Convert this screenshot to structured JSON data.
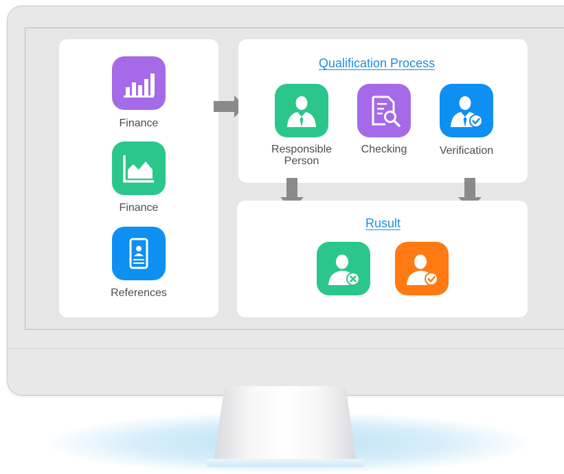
{
  "sources": [
    {
      "label": "Finance",
      "icon": "bar-chart-icon",
      "color": "#a56ae8"
    },
    {
      "label": "Finance",
      "icon": "area-chart-icon",
      "color": "#2bc68c"
    },
    {
      "label": "References",
      "icon": "id-card-icon",
      "color": "#0e8ff2"
    }
  ],
  "process": {
    "title": "Qualification Process ",
    "steps": [
      {
        "label": "Responsible Person",
        "icon": "person-icon",
        "color": "#2bc68c"
      },
      {
        "label": "Checking",
        "icon": "document-search-icon",
        "color": "#a56ae8"
      },
      {
        "label": "Verification",
        "icon": "person-check-icon",
        "color": "#0e8ff2"
      }
    ]
  },
  "result": {
    "title": "Rusult",
    "items": [
      {
        "icon": "person-rejected-icon",
        "color": "#2bc68c"
      },
      {
        "icon": "person-approved-icon",
        "color": "#ff7a12"
      }
    ]
  }
}
